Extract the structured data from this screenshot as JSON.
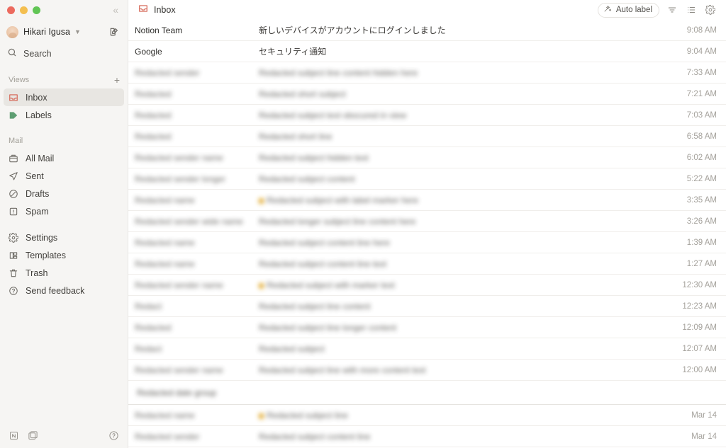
{
  "window": {
    "traffic_lights": [
      "close",
      "minimize",
      "zoom"
    ],
    "collapse_icon": "chevrons-left-icon",
    "colors": {
      "close": "#ec6a5e",
      "minimize": "#f4bf4f",
      "zoom": "#61c554",
      "sidebar_bg": "#f6f5f3",
      "accent_red": "#d4604f",
      "accent_green": "#5e9e72",
      "amber_tag": "#e0a622"
    }
  },
  "sidebar": {
    "account": {
      "name": "Hikari Igusa",
      "caret": "chevron-down-icon",
      "avatar": "avatar",
      "compose_icon": "compose-icon"
    },
    "search": {
      "label": "Search",
      "icon": "search-icon"
    },
    "views_section": {
      "title": "Views",
      "add_icon": "plus-icon"
    },
    "views": [
      {
        "label": "Inbox",
        "icon": "inbox-icon",
        "active": true
      },
      {
        "label": "Labels",
        "icon": "tag-icon",
        "active": false
      }
    ],
    "mail_section": {
      "title": "Mail"
    },
    "mail": [
      {
        "label": "All Mail",
        "icon": "mailbox-icon"
      },
      {
        "label": "Sent",
        "icon": "paper-plane-icon"
      },
      {
        "label": "Drafts",
        "icon": "draft-icon"
      },
      {
        "label": "Spam",
        "icon": "spam-icon"
      }
    ],
    "utility": [
      {
        "label": "Settings",
        "icon": "gear-icon"
      },
      {
        "label": "Templates",
        "icon": "templates-icon"
      },
      {
        "label": "Trash",
        "icon": "trash-icon"
      },
      {
        "label": "Send feedback",
        "icon": "question-circle-icon"
      }
    ],
    "footer": [
      {
        "icon": "notion-icon"
      },
      {
        "icon": "notion-calendar-icon"
      },
      {
        "icon": "help-circle-icon"
      }
    ]
  },
  "main": {
    "header": {
      "title": "Inbox",
      "title_icon": "inbox-icon",
      "auto_label": {
        "label": "Auto label",
        "icon": "sparkle-wand-icon"
      },
      "filter_icon": "filter-icon",
      "density_icon": "list-view-icon",
      "settings_icon": "gear-icon"
    },
    "columns": [
      "sender",
      "subject",
      "time"
    ],
    "emails": [
      {
        "sender": "Notion Team",
        "subject": "新しいデバイスがアカウントにログインしました",
        "time": "9:08 AM",
        "redacted": false,
        "tag": false
      },
      {
        "sender": "Google",
        "subject": "セキュリティ通知",
        "time": "9:04 AM",
        "redacted": false,
        "tag": false
      },
      {
        "sender": "Redacted sender",
        "subject": "Redacted subject line content hidden here",
        "time": "7:33 AM",
        "redacted": true,
        "tag": false
      },
      {
        "sender": "Redacted",
        "subject": "Redacted short subject",
        "time": "7:21 AM",
        "redacted": true,
        "tag": false
      },
      {
        "sender": "Redacted",
        "subject": "Redacted subject text obscured in view",
        "time": "7:03 AM",
        "redacted": true,
        "tag": false
      },
      {
        "sender": "Redacted",
        "subject": "Redacted short line",
        "time": "6:58 AM",
        "redacted": true,
        "tag": false
      },
      {
        "sender": "Redacted sender name",
        "subject": "Redacted subject hidden text",
        "time": "6:02 AM",
        "redacted": true,
        "tag": false
      },
      {
        "sender": "Redacted sender longer",
        "subject": "Redacted subject content",
        "time": "5:22 AM",
        "redacted": true,
        "tag": false
      },
      {
        "sender": "Redacted name",
        "subject": "Redacted subject with label marker here",
        "time": "3:35 AM",
        "redacted": true,
        "tag": true
      },
      {
        "sender": "Redacted sender wide name",
        "subject": "Redacted longer subject line content here",
        "time": "3:26 AM",
        "redacted": true,
        "tag": false
      },
      {
        "sender": "Redacted name",
        "subject": "Redacted subject content line here",
        "time": "1:39 AM",
        "redacted": true,
        "tag": false
      },
      {
        "sender": "Redacted name",
        "subject": "Redacted subject content line text",
        "time": "1:27 AM",
        "redacted": true,
        "tag": false
      },
      {
        "sender": "Redacted sender name",
        "subject": "Redacted subject with marker text",
        "time": "12:30 AM",
        "redacted": true,
        "tag": true
      },
      {
        "sender": "Redact",
        "subject": "Redacted subject line content",
        "time": "12:23 AM",
        "redacted": true,
        "tag": false
      },
      {
        "sender": "Redacted",
        "subject": "Redacted subject line longer content",
        "time": "12:09 AM",
        "redacted": true,
        "tag": false
      },
      {
        "sender": "Redact",
        "subject": "Redacted subject",
        "time": "12:07 AM",
        "redacted": true,
        "tag": false
      },
      {
        "sender": "Redacted sender name",
        "subject": "Redacted subject line with more content text",
        "time": "12:00 AM",
        "redacted": true,
        "tag": false
      }
    ],
    "divider_header": "Redacted date group",
    "older_emails": [
      {
        "sender": "Redacted name",
        "subject": "Redacted subject line",
        "time": "Mar 14",
        "redacted": true,
        "tag": true
      },
      {
        "sender": "Redacted sender",
        "subject": "Redacted subject content line",
        "time": "Mar 14",
        "redacted": true,
        "tag": false
      }
    ]
  }
}
